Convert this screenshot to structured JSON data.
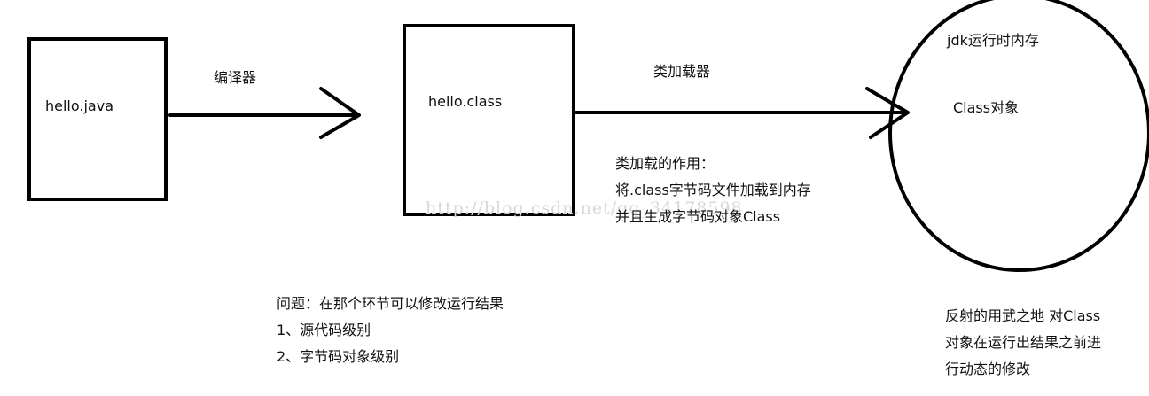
{
  "boxes": {
    "source": {
      "label": "hello.java"
    },
    "bytecode": {
      "label": "hello.class"
    }
  },
  "memory": {
    "title": "jdk运行时内存",
    "object": "Class对象"
  },
  "arrows": {
    "compiler": "编译器",
    "classloader": "类加载器"
  },
  "classloader_note": {
    "lines": [
      "类加载的作用：",
      "将.class字节码文件加载到内存",
      "并且生成字节码对象Class"
    ]
  },
  "question": {
    "lines": [
      "问题：在那个环节可以修改运行结果",
      "1、源代码级别",
      "2、字节码对象级别"
    ]
  },
  "reflection_note": {
    "lines": [
      "反射的用武之地 对Class",
      "对象在运行出结果之前进",
      "行动态的修改"
    ]
  },
  "watermark": "http://blog.csdn.net/qq_34178598"
}
